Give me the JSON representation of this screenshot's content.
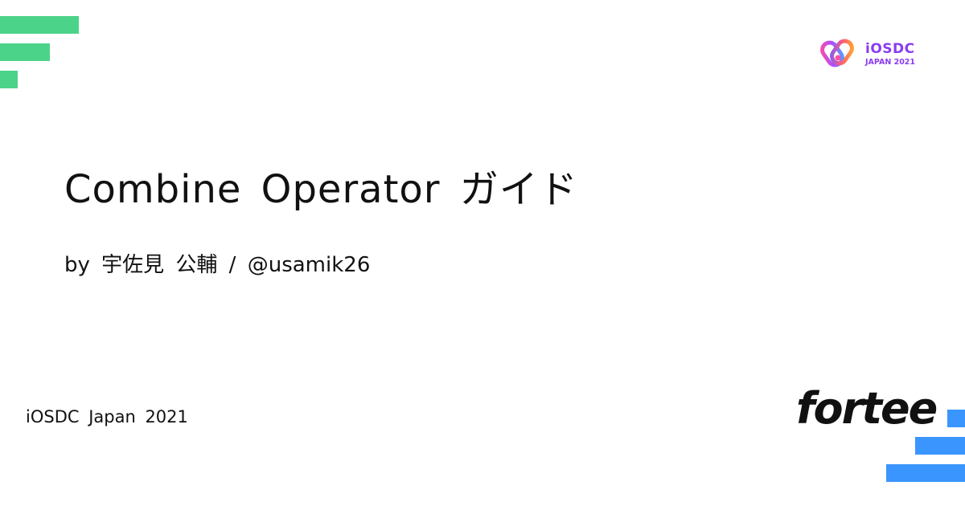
{
  "card": {
    "title": "Combine Operator ガイド",
    "byline": "by 宇佐見 公輔 / @usamik26",
    "event": "iOSDC Japan 2021"
  },
  "logos": {
    "conference_logo": {
      "icon": "iosdc-infinity-icon",
      "name": "iOSDC",
      "subtitle": "JAPAN 2021"
    },
    "platform_logo": {
      "text": "fortee"
    }
  },
  "colors": {
    "accent_green": "#4cd38a",
    "accent_blue": "#3b95ff",
    "logo_purple": "#8a3cf0",
    "text": "#111111",
    "background": "#ffffff"
  }
}
